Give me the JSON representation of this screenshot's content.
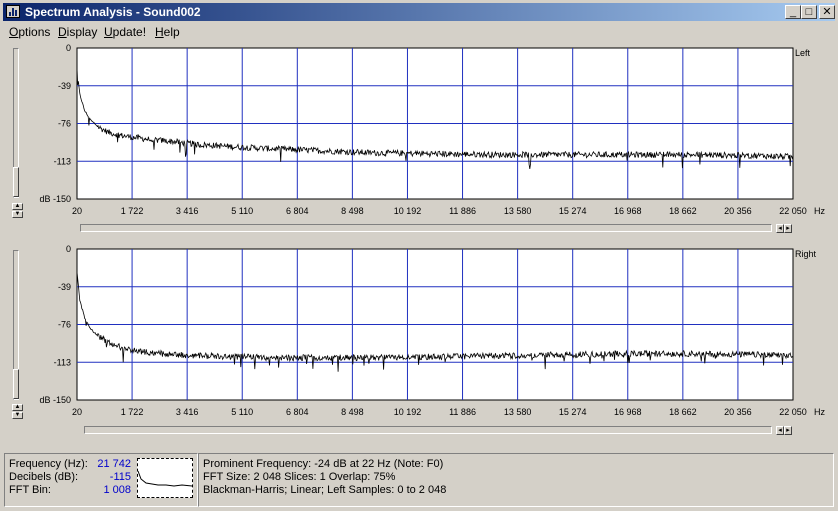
{
  "window": {
    "title": "Spectrum Analysis - Sound002",
    "min_label": "_",
    "max_label": "□",
    "close_label": "✕"
  },
  "menu": [
    {
      "pre": "",
      "key": "O",
      "post": "ptions"
    },
    {
      "pre": "",
      "key": "D",
      "post": "isplay"
    },
    {
      "pre": "",
      "key": "U",
      "post": "pdate!"
    },
    {
      "pre": "",
      "key": "H",
      "post": "elp"
    }
  ],
  "colors": {
    "grid": "#2030c0",
    "trace": "#000000",
    "titlebar_start": "#0a246a",
    "titlebar_end": "#a6caf0",
    "readout": "#0000cc"
  },
  "x_unit": "Hz",
  "y_unit": "dB",
  "chart_data": [
    {
      "type": "line",
      "title": "Left",
      "xlabel": "Hz",
      "ylabel": "dB",
      "xlim": [
        20,
        22050
      ],
      "ylim": [
        -150,
        0
      ],
      "x_ticks": [
        "20",
        "1 722",
        "3 416",
        "5 110",
        "6 804",
        "8 498",
        "10 192",
        "11 886",
        "13 580",
        "15 274",
        "16 968",
        "18 662",
        "20 356",
        "22 050"
      ],
      "y_ticks": [
        "0",
        "-39",
        "-76",
        "-113",
        "dB -150"
      ],
      "grid": true,
      "series": [
        {
          "x": [
            20,
            100,
            250,
            450,
            700,
            1000,
            1400,
            1800,
            2300,
            3000,
            3800,
            4800,
            6000,
            7500,
            9000,
            11000,
            13000,
            15000,
            17000,
            19000,
            21000,
            22050
          ],
          "y": [
            -20,
            -45,
            -62,
            -72,
            -79,
            -84,
            -87,
            -89,
            -91,
            -93,
            -96,
            -98,
            -100,
            -102,
            -104,
            -105,
            -106,
            -106,
            -106,
            -106,
            -107,
            -108
          ]
        }
      ]
    },
    {
      "type": "line",
      "title": "Right",
      "xlabel": "Hz",
      "ylabel": "dB",
      "xlim": [
        20,
        22050
      ],
      "ylim": [
        -150,
        0
      ],
      "x_ticks": [
        "20",
        "1 722",
        "3 416",
        "5 110",
        "6 804",
        "8 498",
        "10 192",
        "11 886",
        "13 580",
        "15 274",
        "16 968",
        "18 662",
        "20 356",
        "22 050"
      ],
      "y_ticks": [
        "0",
        "-39",
        "-76",
        "-113",
        "dB -150"
      ],
      "grid": true,
      "series": [
        {
          "x": [
            20,
            100,
            250,
            450,
            700,
            1000,
            1400,
            1800,
            2300,
            3000,
            3800,
            4800,
            6000,
            7500,
            9000,
            11000,
            13000,
            15000,
            17000,
            19000,
            21000,
            22050
          ],
          "y": [
            -22,
            -50,
            -68,
            -80,
            -87,
            -93,
            -98,
            -101,
            -103,
            -105,
            -106,
            -107,
            -108,
            -108,
            -108,
            -107,
            -106,
            -105,
            -104,
            -104,
            -105,
            -106
          ]
        }
      ]
    }
  ],
  "status": {
    "frequency_label": "Frequency (Hz):",
    "frequency_value": "21 742",
    "decibels_label": "Decibels (dB):",
    "decibels_value": "-115",
    "fft_bin_label": "FFT Bin:",
    "fft_bin_value": "1 008",
    "line1": "Prominent Frequency: -24 dB at 22 Hz (Note: F0)",
    "line2": "FFT Size: 2 048  Slices: 1  Overlap: 75%",
    "line3": "Blackman-Harris; Linear; Left  Samples: 0 to 2 048"
  }
}
